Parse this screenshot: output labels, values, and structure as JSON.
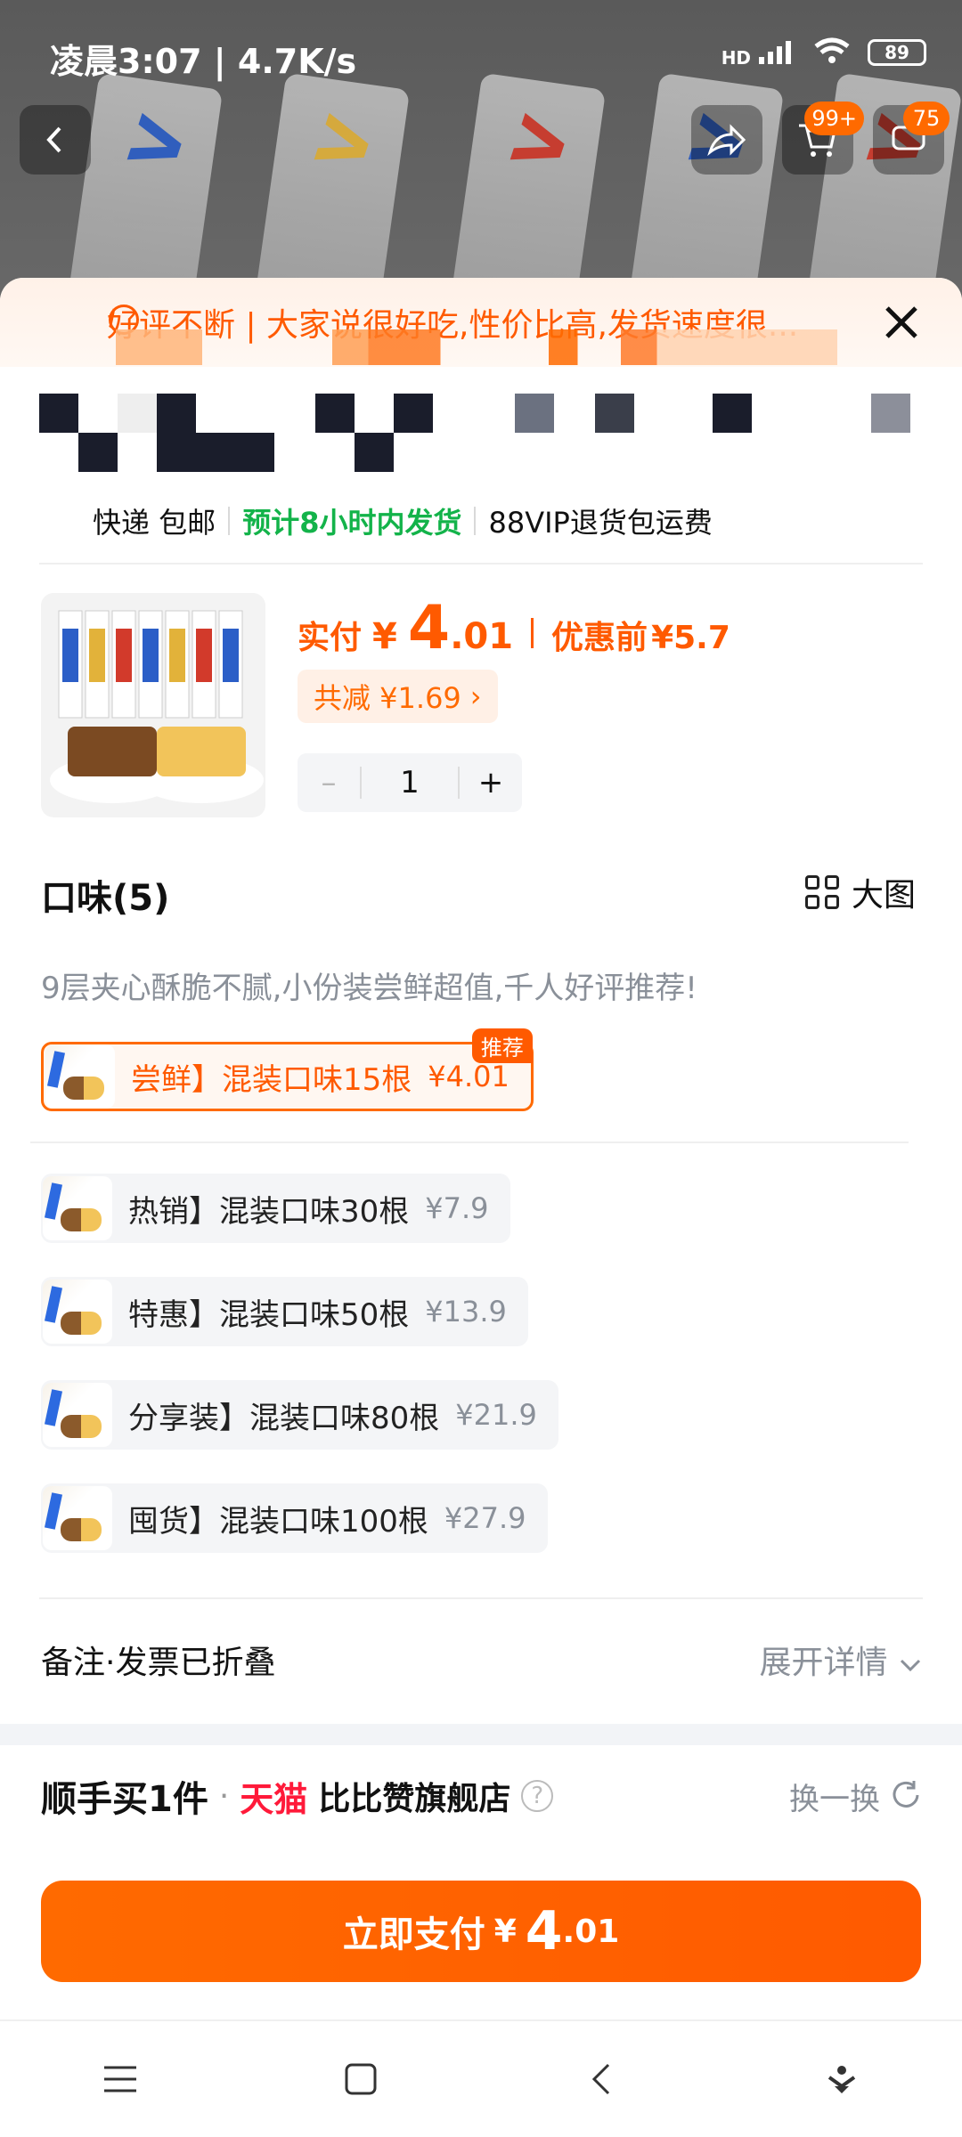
{
  "status_bar": {
    "time": "凌晨3:07",
    "net_speed": "4.7K/s",
    "signal": "HD",
    "battery": "89"
  },
  "top_buttons": {
    "back_icon": "back-icon",
    "share_icon": "share-icon",
    "cart_badge": "99+",
    "message_badge": "75"
  },
  "notice": {
    "text": "好评不断 | 大家说很好吃,性价比高,发货速度很..."
  },
  "shipping": {
    "method": "快递 包邮",
    "ship_time": "预计8小时内发货",
    "vip": "88VIP退货包运费"
  },
  "price": {
    "label": "实付",
    "currency": "¥",
    "int": "4",
    "dec": ".01",
    "orig_label": "优惠前",
    "orig": "¥5.7",
    "discount": "共减 ¥1.69",
    "discount_arrow": "›"
  },
  "quantity": {
    "minus": "–",
    "value": "1",
    "plus": "+"
  },
  "flavor": {
    "title": "口味(5)",
    "big_view": "大图",
    "desc": "9层夹心酥脆不腻,小份装尝鲜超值,千人好评推荐!",
    "recommended_tag": "推荐",
    "options": [
      {
        "name": "尝鲜】混装口味15根",
        "price": "¥4.01",
        "selected": true
      },
      {
        "name": "热销】混装口味30根",
        "price": "¥7.9",
        "selected": false
      },
      {
        "name": "特惠】混装口味50根",
        "price": "¥13.9",
        "selected": false
      },
      {
        "name": "分享装】混装口味80根",
        "price": "¥21.9",
        "selected": false
      },
      {
        "name": "囤货】混装口味100根",
        "price": "¥27.9",
        "selected": false
      }
    ]
  },
  "notes": {
    "label": "备注·发票已折叠",
    "expand": "展开详情"
  },
  "shop": {
    "promo": "顺手买1件",
    "dot": "·",
    "mall": "天猫",
    "name": "比比赞旗舰店",
    "help": "?",
    "swap": "换一换"
  },
  "pay": {
    "label": "立即支付",
    "currency": "¥",
    "int": "4",
    "dec": ".01"
  },
  "colors": {
    "accent": "#ff5a00",
    "green": "#13b34a",
    "tmall": "#ff1a3a"
  }
}
